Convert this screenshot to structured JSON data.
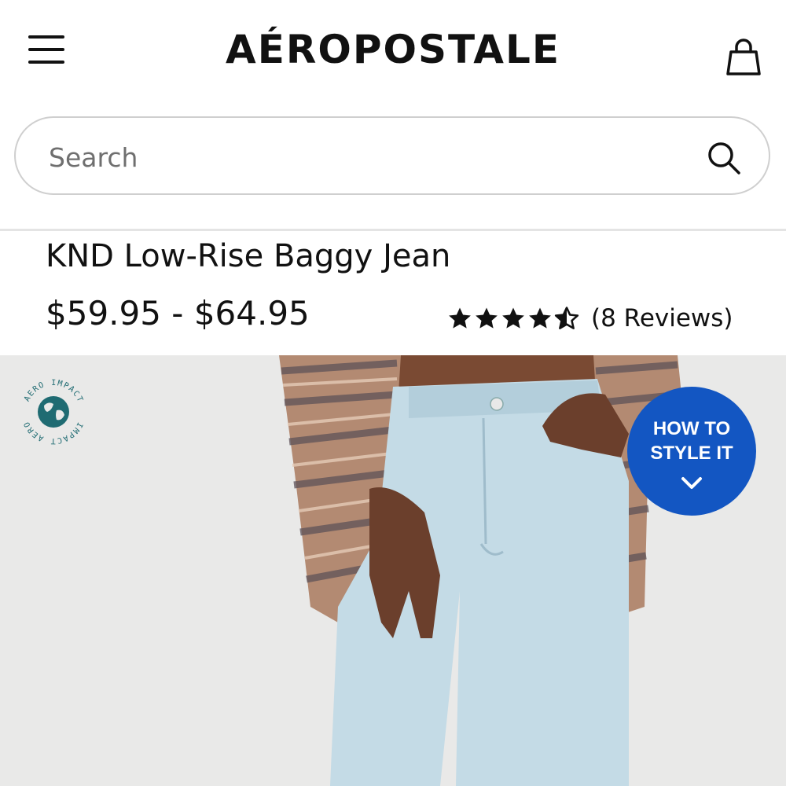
{
  "header": {
    "logo": "AÉROPOSTALE",
    "menu_icon": "hamburger-menu-icon",
    "bag_icon": "shopping-bag-icon"
  },
  "search": {
    "placeholder": "Search",
    "value": "",
    "icon": "search-icon"
  },
  "product": {
    "title": "KND Low-Rise Baggy Jean",
    "price": "$59.95 - $64.95",
    "rating": {
      "value": 4.5,
      "max": 5,
      "review_text": "(8 Reviews)"
    }
  },
  "image_overlay": {
    "badge_top_text": "AERO IMPACT",
    "badge_bottom_text": "IMPACT AERO",
    "badge_icon": "globe-icon",
    "style_button_label": "HOW TO\nSTYLE IT",
    "style_button_icon": "chevron-down-icon"
  },
  "colors": {
    "accent_blue": "#1356c2",
    "badge_teal": "#1f6b72",
    "image_background": "#e9e9e8",
    "text": "#111111"
  }
}
